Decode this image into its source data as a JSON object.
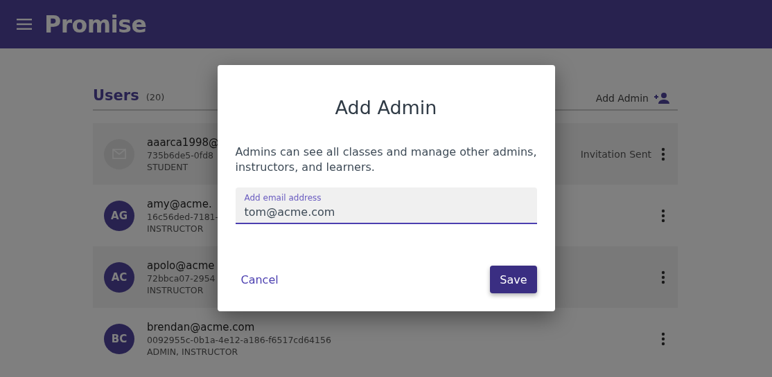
{
  "app_bar": {
    "title": "Promise"
  },
  "users": {
    "title": "Users",
    "count": "(20)",
    "add_button": "Add Admin",
    "rows": [
      {
        "kind": "invited",
        "email": "aaarca1998@",
        "id": "735b6de5-0fd8",
        "role": "STUDENT",
        "status": "Invitation Sent"
      },
      {
        "kind": "member",
        "initials": "AG",
        "email": "amy@acme.",
        "id": "16c56ded-7181-",
        "role": "INSTRUCTOR"
      },
      {
        "kind": "member",
        "initials": "AC",
        "email": "apolo@acme",
        "id": "72bbca07-2954",
        "role": "INSTRUCTOR"
      },
      {
        "kind": "member",
        "initials": "BC",
        "email": "brendan@acme.com",
        "id": "0092955c-0b1a-4e12-a186-f6517cd64156",
        "role": "ADMIN, INSTRUCTOR"
      }
    ]
  },
  "dialog": {
    "title": "Add Admin",
    "text": "Admins can see all classes and manage other admins, instructors, and learners.",
    "field": {
      "label": "Add email address",
      "value": "tom@acme.com"
    },
    "buttons": [
      {
        "label": "Cancel",
        "kind": "text"
      },
      {
        "label": "Save",
        "kind": "primary"
      }
    ]
  }
}
